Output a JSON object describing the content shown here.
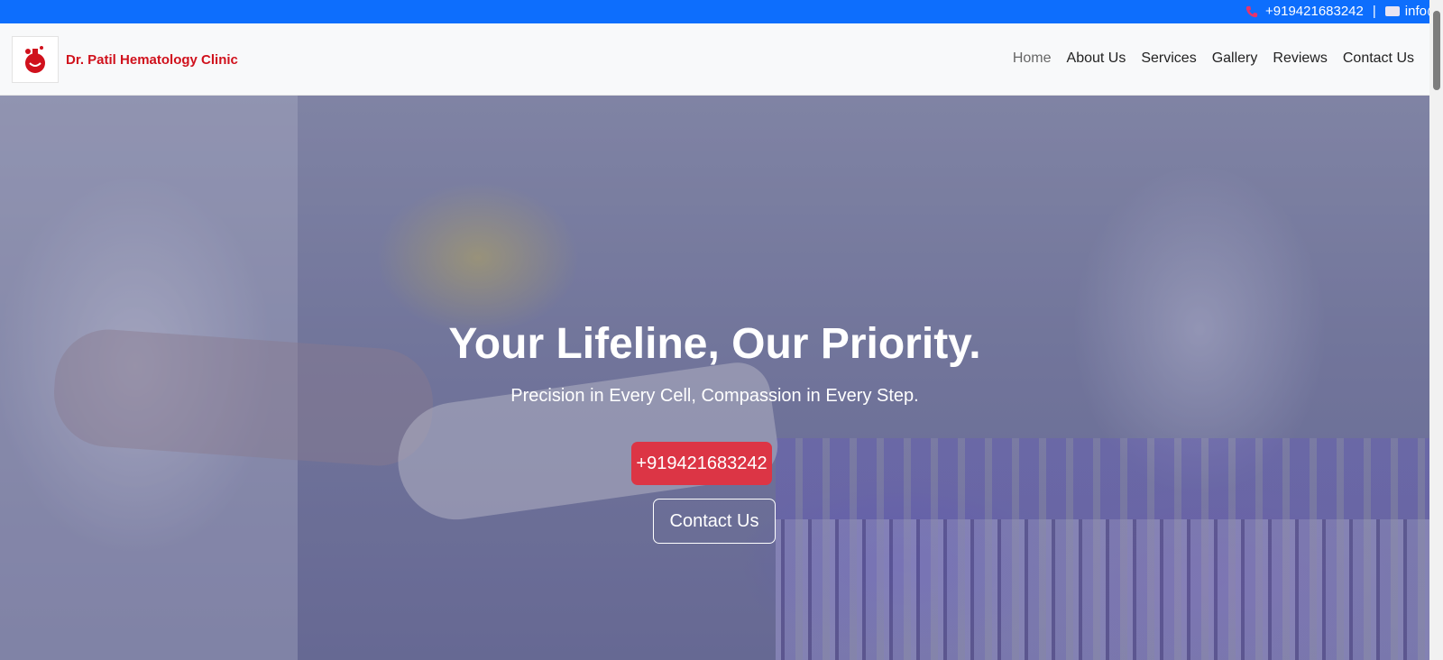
{
  "topbar": {
    "phone": "+919421683242",
    "separator": "|",
    "email": "info@",
    "icons": {
      "phone": "phone-icon",
      "email": "mail-icon"
    }
  },
  "brand": {
    "name": "Dr. Patil Hematology Clinic",
    "logo_icon": "flask-drop-icon",
    "color": "#d0111c"
  },
  "nav": {
    "items": [
      {
        "label": "Home",
        "active": true
      },
      {
        "label": "About Us"
      },
      {
        "label": "Services"
      },
      {
        "label": "Gallery"
      },
      {
        "label": "Reviews"
      },
      {
        "label": "Contact Us"
      }
    ]
  },
  "hero": {
    "title": "Your Lifeline, Our Priority.",
    "subtitle": "Precision in Every Cell, Compassion in Every Step.",
    "phone_button": "+919421683242",
    "contact_button": "Contact Us"
  },
  "colors": {
    "topbar": "#0d6efd",
    "accent_button": "#dc3545",
    "navbar_bg": "#f8f9fa"
  }
}
